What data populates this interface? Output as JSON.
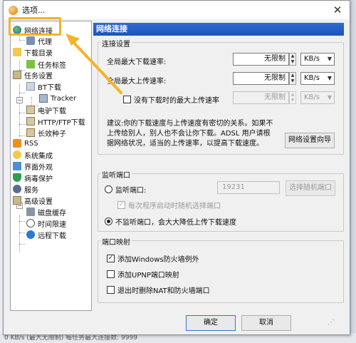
{
  "window": {
    "title": "选项..."
  },
  "background": {
    "status_text": "0 KB/s (最大无限制)      每任务最大连接数: 9999"
  },
  "tree": {
    "items": [
      {
        "label": "网络连接"
      },
      {
        "label": "代理"
      },
      {
        "label": "下载目录"
      },
      {
        "label": "任务标签"
      },
      {
        "label": "任务设置"
      },
      {
        "label": "BT下载"
      },
      {
        "label": "Tracker"
      },
      {
        "label": "电驴下载"
      },
      {
        "label": "HTTP/FTP下载"
      },
      {
        "label": "长效种子"
      },
      {
        "label": "RSS"
      },
      {
        "label": "系统集成"
      },
      {
        "label": "界面外观"
      },
      {
        "label": "病毒保护"
      },
      {
        "label": "服务"
      },
      {
        "label": "高级设置"
      },
      {
        "label": "磁盘缓存"
      },
      {
        "label": "时间限速"
      },
      {
        "label": "远程下载"
      }
    ]
  },
  "panel": {
    "title": "网络连接",
    "connection": {
      "group_title": "连接设置",
      "max_download_label": "全局最大下载速率:",
      "max_download_value": "无限制",
      "max_download_unit": "KB/s",
      "max_upload_label": "全局最大上传速率:",
      "max_upload_value": "无限制",
      "max_upload_unit": "KB/s",
      "no_task_upload_label": "没有下载时的最大上传速率",
      "no_task_upload_value": "无限制",
      "no_task_upload_unit": "KB/s",
      "hint": "建议:你的下载速度与上传速度有密切的关系。如果不上传给别人，别人也不会让你下载。ADSL 用户请根据网络状况，适当的上传速率，以提高下载速度。",
      "wizard_button": "网络设置向导"
    },
    "listen": {
      "group_title": "监听端口",
      "listen_label": "监听端口:",
      "port_value": "19231",
      "random_button": "选择随机端口",
      "random_each_start_label": "每次程序启动时随机选择端口",
      "no_listen_label": "不监听端口，会大大降低上传下载速度"
    },
    "mapping": {
      "group_title": "端口映射",
      "firewall_label": "添加Windows防火墙例外",
      "upnp_label": "添加UPNP端口映射",
      "remove_on_exit_label": "退出时删除NAT和防火墙端口"
    }
  },
  "footer": {
    "ok_label": "确定",
    "cancel_label": "取消"
  },
  "colors": {
    "highlight": "#f5b326",
    "header": "#2f6bd4"
  }
}
